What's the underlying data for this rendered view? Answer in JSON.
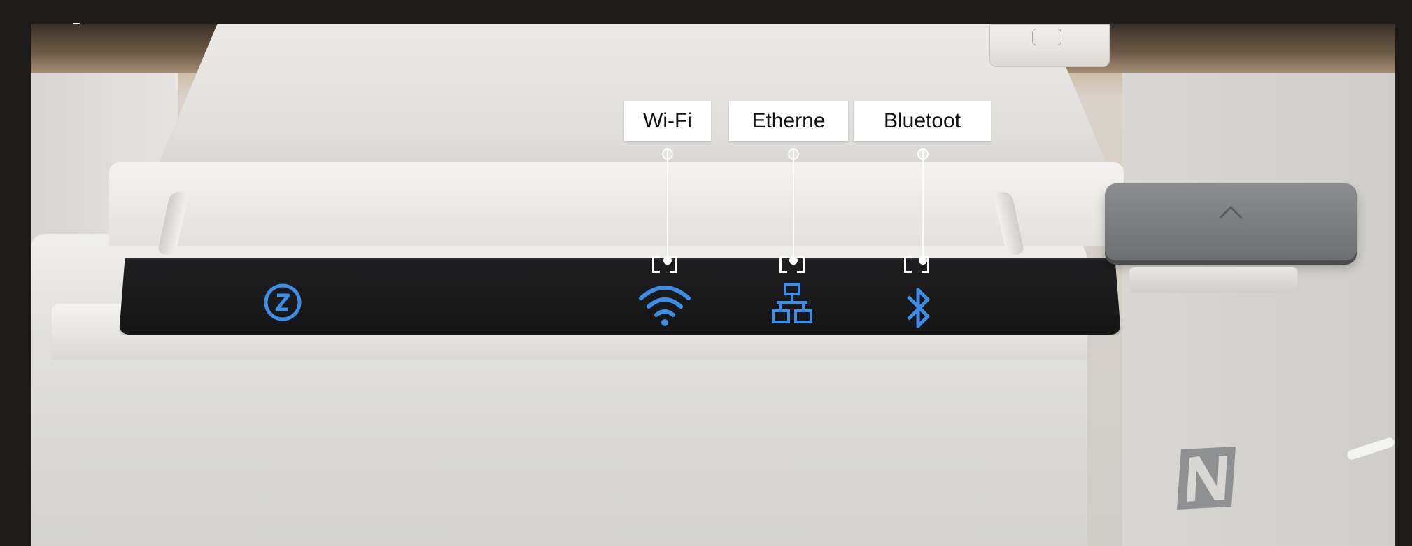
{
  "callouts": {
    "wifi": "Wi-Fi",
    "ethernet": "Etherne",
    "bluetooth": "Bluetoot"
  },
  "icons": {
    "power": "power-status-icon",
    "wifi": "wifi-icon",
    "ethernet": "ethernet-icon",
    "bluetooth": "bluetooth-icon",
    "nfc": "nfc-icon"
  },
  "colors": {
    "led_blue": "#3d8ee8",
    "panel": "#1a1a1b",
    "callout_bg": "#ffffff"
  }
}
